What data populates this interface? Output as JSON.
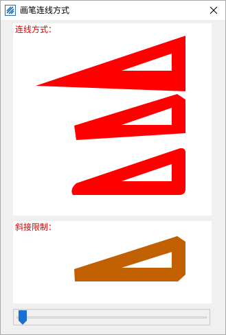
{
  "window": {
    "title": "画笔连线方式",
    "icon": "app-logo-icon",
    "close_icon": "close-icon"
  },
  "panels": [
    {
      "label": "连线方式："
    },
    {
      "label": "斜接限制："
    }
  ],
  "slider": {
    "value_fraction": 0.0
  },
  "colors": {
    "label": "#e00000",
    "shape_red": "#ff0000",
    "shape_orange": "#c06000",
    "slider_thumb": "#1a6fd0"
  }
}
